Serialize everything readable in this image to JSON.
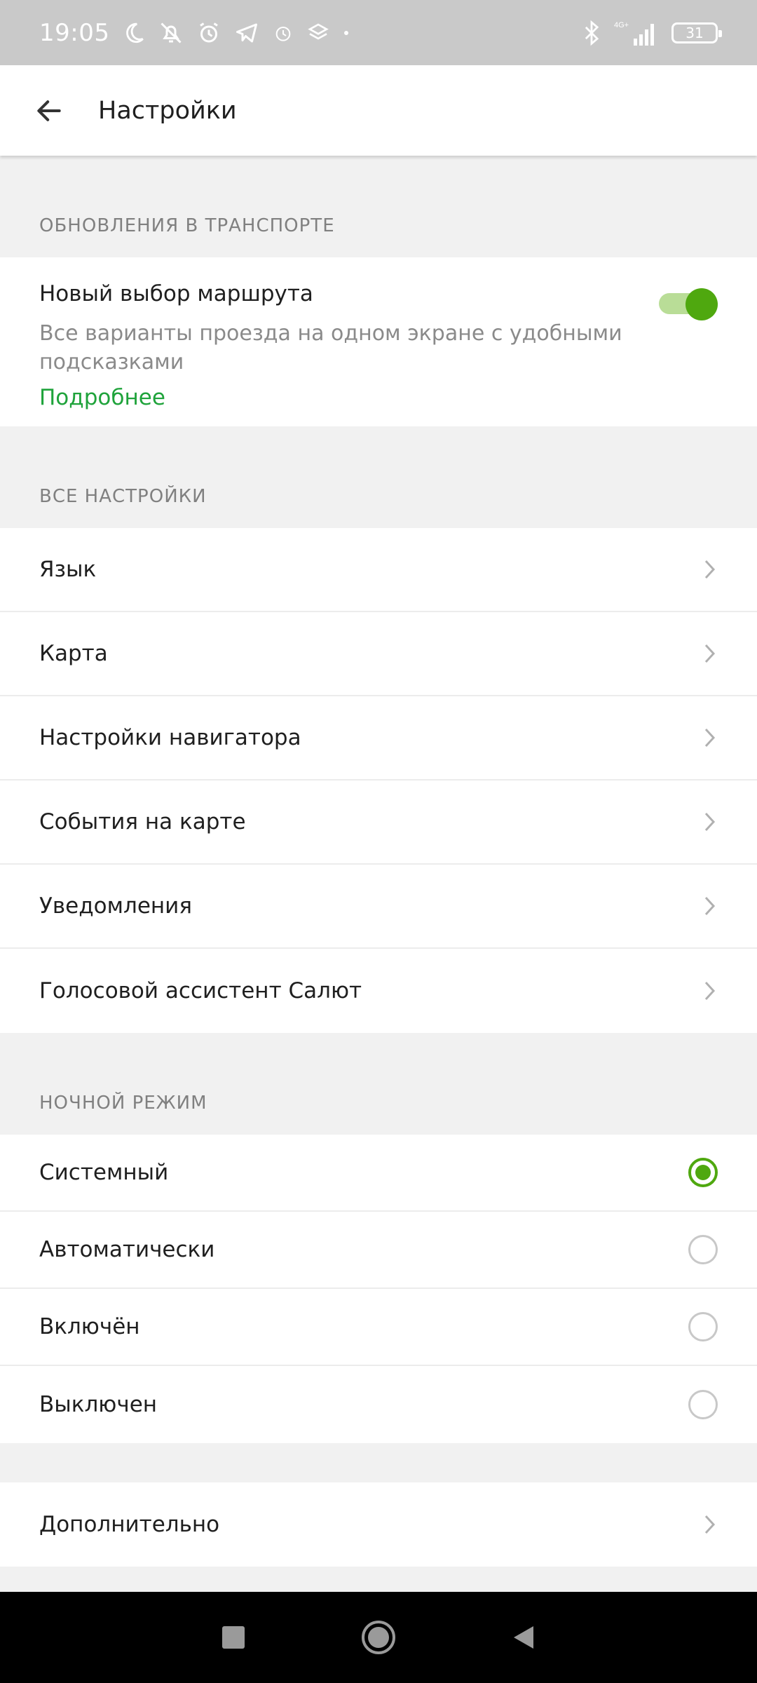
{
  "status_bar": {
    "time": "19:05",
    "battery": "31",
    "network": "4G+"
  },
  "appbar": {
    "title": "Настройки"
  },
  "sections": {
    "transport": {
      "header": "Обновления в транспорте",
      "feature": {
        "title": "Новый выбор маршрута",
        "description": "Все варианты проезда на одном экране с удобными подсказками",
        "link": "Подробнее",
        "enabled": true
      }
    },
    "all_settings": {
      "header": "Все настройки",
      "items": [
        {
          "label": "Язык"
        },
        {
          "label": "Карта"
        },
        {
          "label": "Настройки навигатора"
        },
        {
          "label": "События на карте"
        },
        {
          "label": "Уведомления"
        },
        {
          "label": "Голосовой ассистент Салют"
        }
      ]
    },
    "night_mode": {
      "header": "Ночной режим",
      "options": [
        {
          "label": "Системный",
          "selected": true
        },
        {
          "label": "Автоматически",
          "selected": false
        },
        {
          "label": "Включён",
          "selected": false
        },
        {
          "label": "Выключен",
          "selected": false
        }
      ]
    },
    "extra": {
      "label": "Дополнительно"
    }
  },
  "colors": {
    "accent": "#4fa80f",
    "link": "#1fa33b",
    "status_bar": "#c9c9c9"
  }
}
